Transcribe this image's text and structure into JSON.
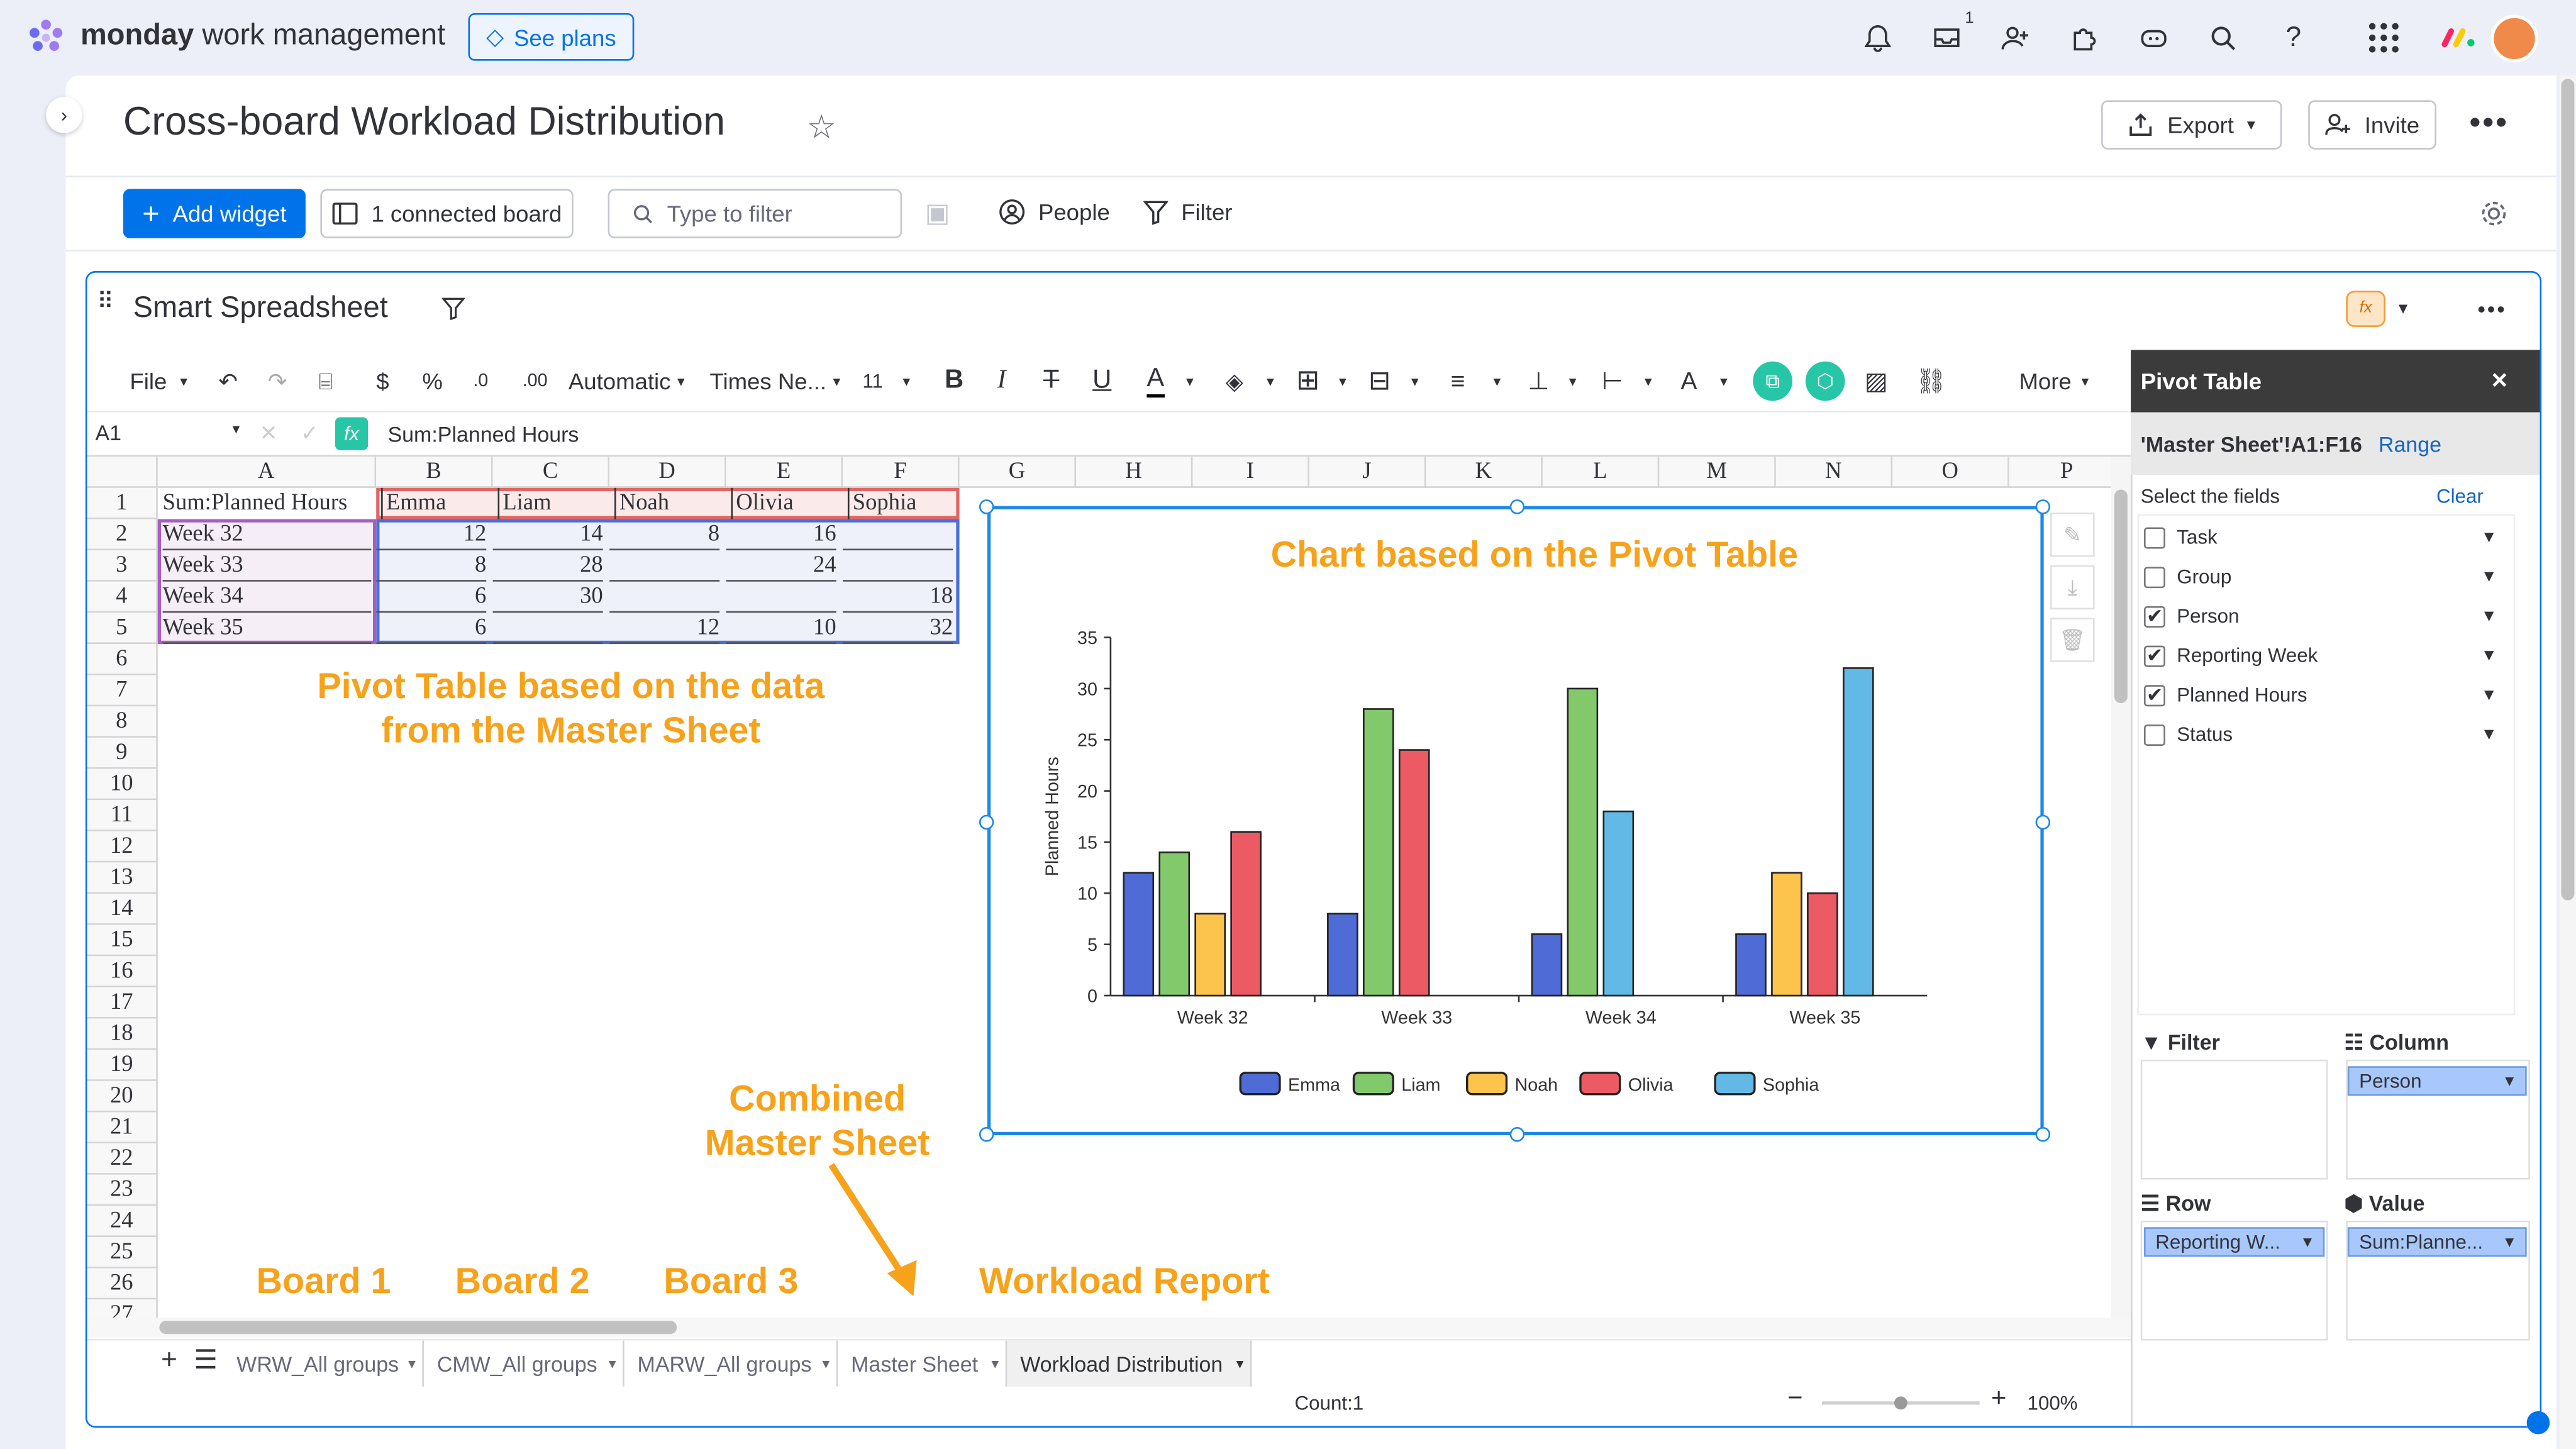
{
  "app": {
    "brand_strong": "monday",
    "brand_rest": " work management",
    "see_plans": "See plans",
    "inbox_badge": "1"
  },
  "page": {
    "title": "Cross-board Workload Distribution",
    "export": "Export",
    "invite": "Invite"
  },
  "controls": {
    "add_widget": "Add widget",
    "connected_board": "1 connected board",
    "filter_placeholder": "Type to filter",
    "people": "People",
    "filter": "Filter"
  },
  "widget": {
    "title": "Smart Spreadsheet"
  },
  "toolbar": {
    "file": "File",
    "currency": "$",
    "percent": "%",
    "format": "Automatic",
    "font": "Times Ne...",
    "font_size": "11",
    "bold": "B",
    "italic": "I",
    "underline": "U",
    "more": "More"
  },
  "formula": {
    "cell_ref": "A1",
    "fx": "fx",
    "content": "Sum:Planned Hours"
  },
  "sheet": {
    "columns": [
      "A",
      "B",
      "C",
      "D",
      "E",
      "F",
      "G",
      "H",
      "I",
      "J",
      "K",
      "L",
      "M",
      "N",
      "O",
      "P"
    ],
    "rows": [
      "1",
      "2",
      "3",
      "4",
      "5",
      "6",
      "7",
      "8",
      "9",
      "10",
      "11",
      "12",
      "13",
      "14",
      "15",
      "16",
      "17",
      "18",
      "19",
      "20",
      "21",
      "22",
      "23",
      "24",
      "25",
      "26",
      "27"
    ],
    "header_row": [
      "Sum:Planned Hours",
      "Emma",
      "Liam",
      "Noah",
      "Olivia",
      "Sophia"
    ],
    "data_rows": [
      [
        "Week 32",
        "12",
        "14",
        "8",
        "16",
        ""
      ],
      [
        "Week 33",
        "8",
        "28",
        "",
        "24",
        ""
      ],
      [
        "Week 34",
        "6",
        "30",
        "",
        "",
        "18"
      ],
      [
        "Week 35",
        "6",
        "",
        "12",
        "10",
        "32"
      ]
    ]
  },
  "annotations": {
    "pivot_line1": "Pivot Table based on the data",
    "pivot_line2": "from the Master Sheet",
    "combined_line1": "Combined",
    "combined_line2": "Master Sheet",
    "board1": "Board 1",
    "board2": "Board 2",
    "board3": "Board 3",
    "workload": "Workload Report"
  },
  "chart_data": {
    "type": "bar",
    "title": "Chart based on the Pivot Table",
    "ylabel": "Planned Hours",
    "categories": [
      "Week 32",
      "Week 33",
      "Week 34",
      "Week 35"
    ],
    "ylim": [
      0,
      35
    ],
    "yticks": [
      "0",
      "5",
      "10",
      "15",
      "20",
      "25",
      "30",
      "35"
    ],
    "series": [
      {
        "name": "Emma",
        "color": "#4f6bd6",
        "values": [
          12,
          8,
          6,
          6
        ]
      },
      {
        "name": "Liam",
        "color": "#82c96b",
        "values": [
          14,
          28,
          30,
          null
        ]
      },
      {
        "name": "Noah",
        "color": "#fcc44c",
        "values": [
          8,
          null,
          null,
          12
        ]
      },
      {
        "name": "Olivia",
        "color": "#ec5a63",
        "values": [
          16,
          24,
          null,
          10
        ]
      },
      {
        "name": "Sophia",
        "color": "#63b9e6",
        "values": [
          null,
          null,
          18,
          32
        ]
      }
    ],
    "legend": "bottom"
  },
  "tabs": [
    "WRW_All groups",
    "CMW_All groups",
    "MARW_All groups",
    "Master Sheet",
    "Workload Distribution"
  ],
  "statusbar": {
    "count": "Count:1",
    "zoom": "100%"
  },
  "pivot": {
    "title": "Pivot Table",
    "range_ref": "'Master Sheet'!A1:F16",
    "range_btn": "Range",
    "select_fields": "Select the fields",
    "clear": "Clear",
    "fields": [
      {
        "label": "Task",
        "checked": false
      },
      {
        "label": "Group",
        "checked": false
      },
      {
        "label": "Person",
        "checked": true
      },
      {
        "label": "Reporting Week",
        "checked": true
      },
      {
        "label": "Planned Hours",
        "checked": true
      },
      {
        "label": "Status",
        "checked": false
      }
    ],
    "filter": "Filter",
    "column": "Column",
    "row": "Row",
    "value": "Value",
    "column_chip": "Person",
    "row_chip": "Reporting W...",
    "value_chip": "Sum:Planne..."
  }
}
